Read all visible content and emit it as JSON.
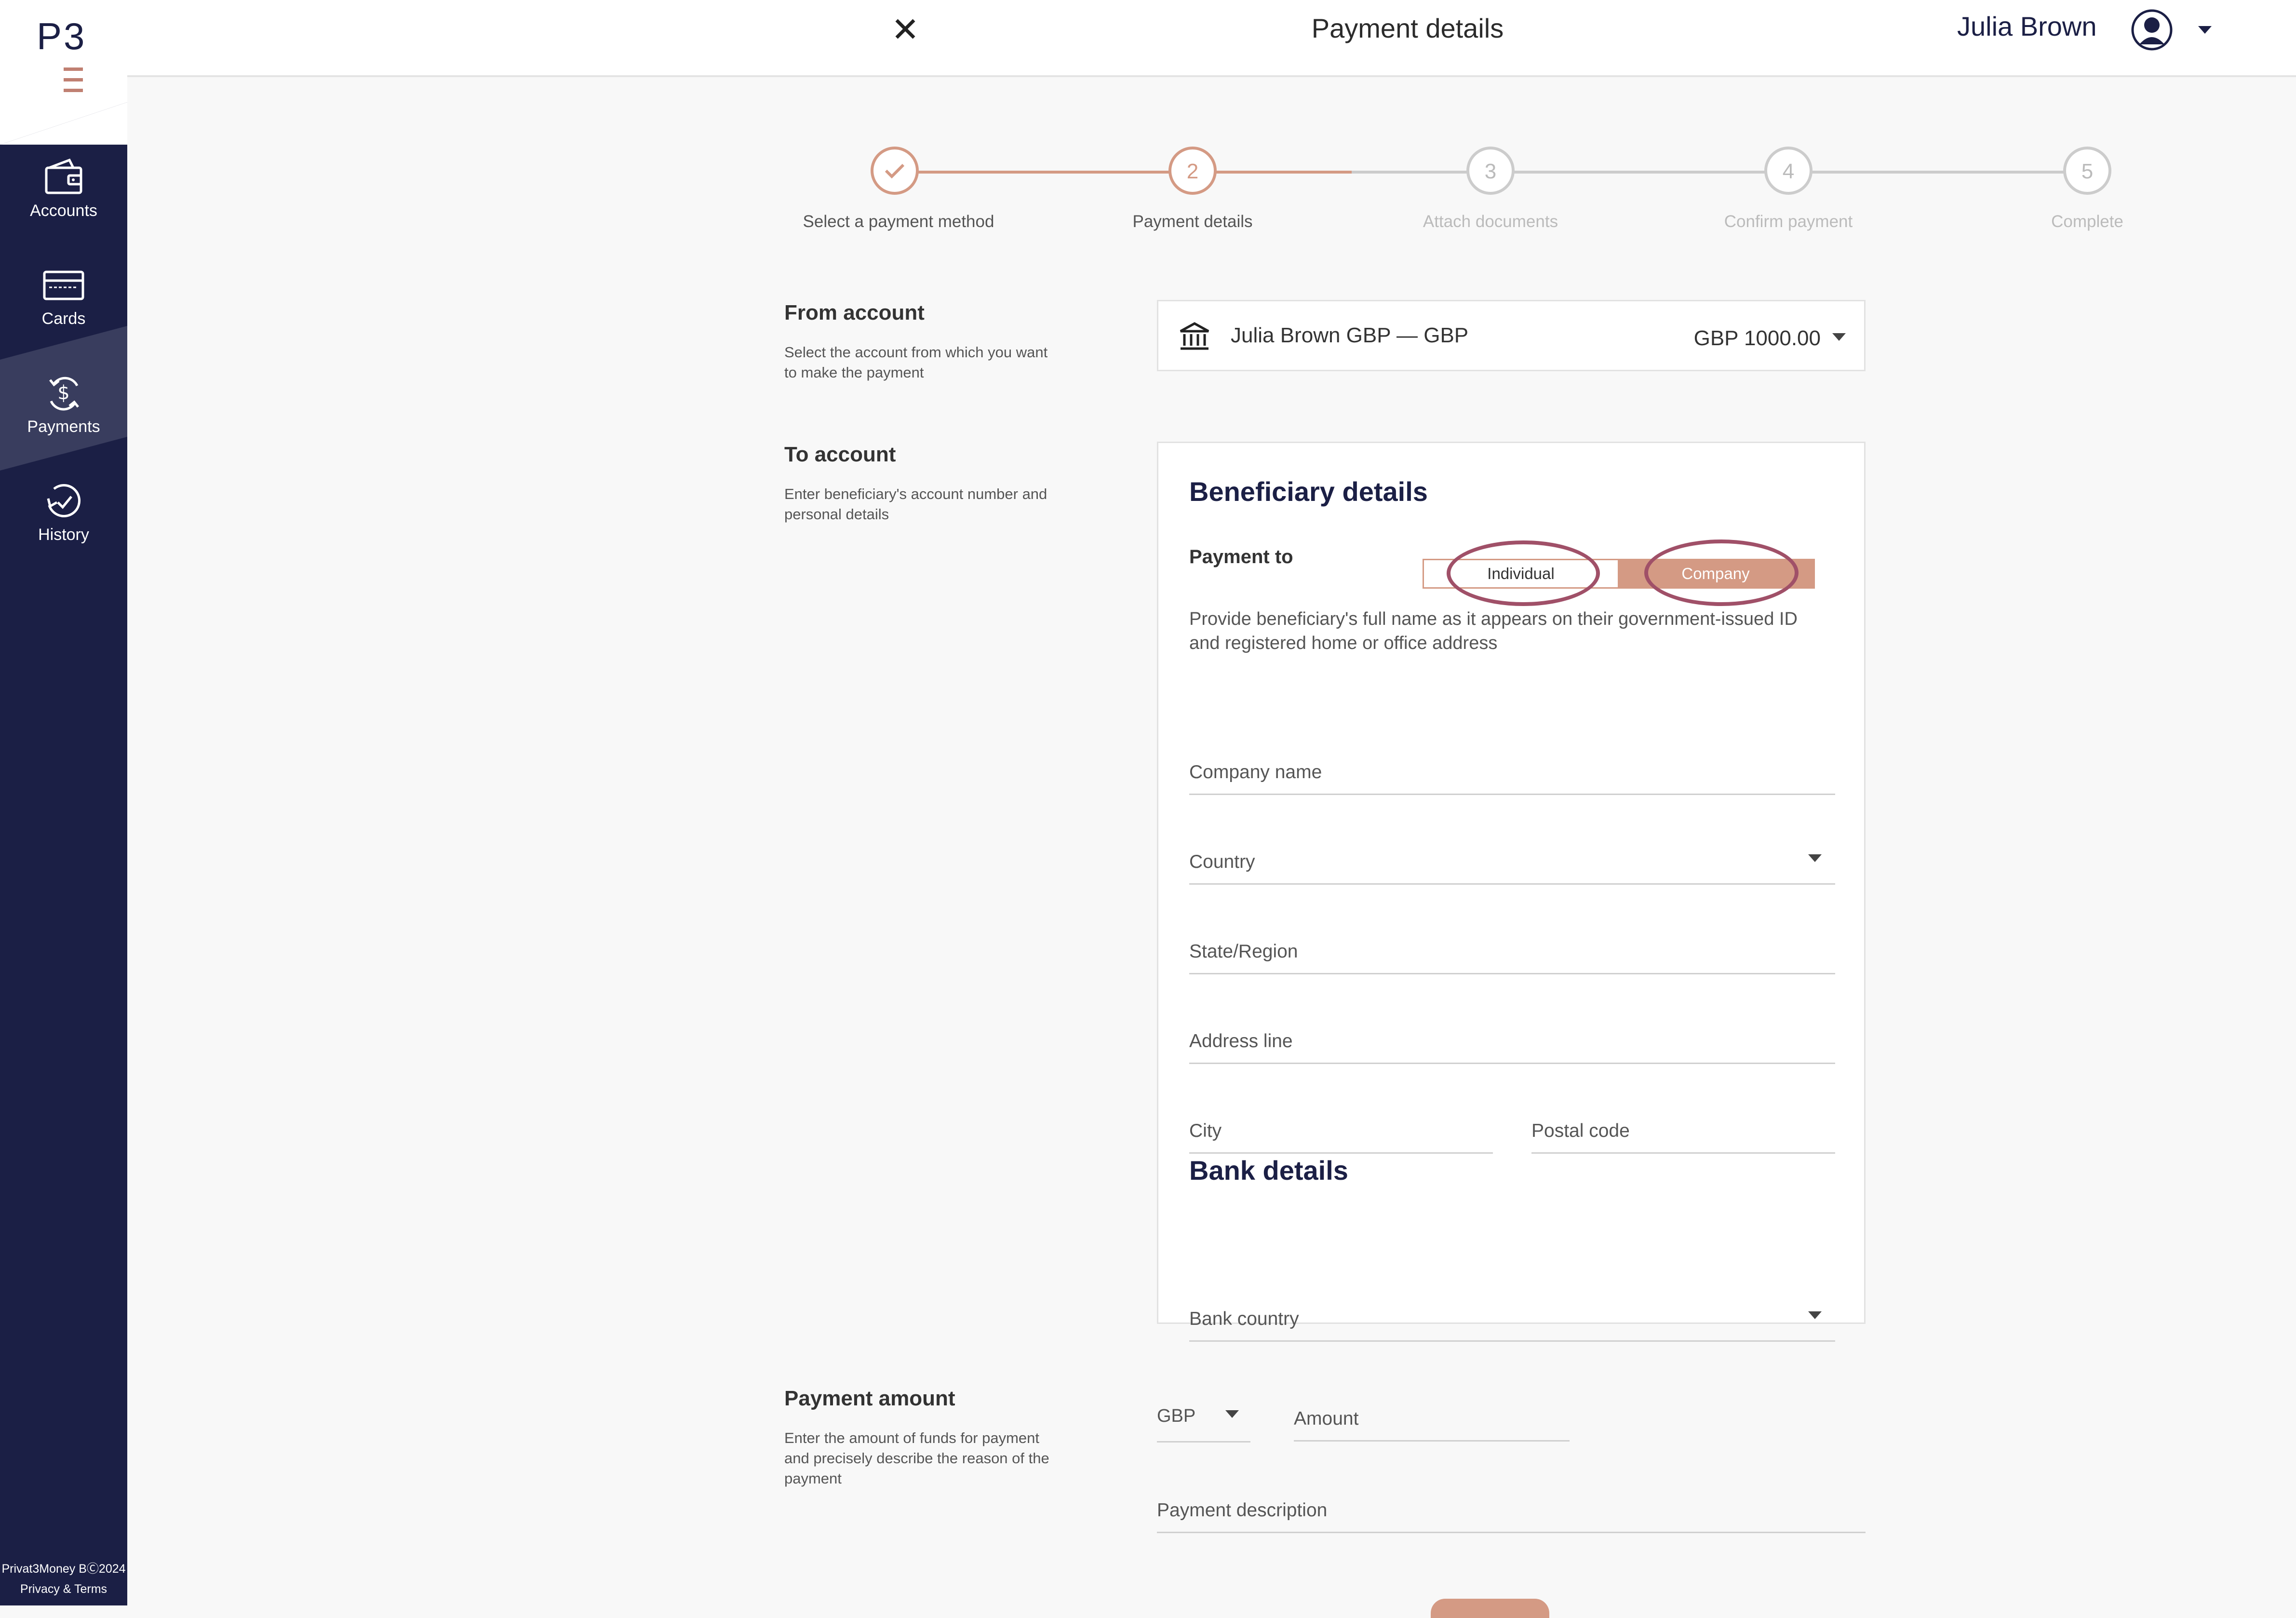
{
  "brand": {
    "logo_text": "P3"
  },
  "sidebar": {
    "items": [
      {
        "label": "Accounts",
        "icon": "wallet-icon",
        "active": false
      },
      {
        "label": "Cards",
        "icon": "card-icon",
        "active": false
      },
      {
        "label": "Payments",
        "icon": "payments-icon",
        "active": true
      },
      {
        "label": "History",
        "icon": "history-icon",
        "active": false
      }
    ],
    "footer": {
      "copyright": "Privat3Money BⒸ2024",
      "privacy": "Privacy & Terms"
    }
  },
  "header": {
    "title": "Payment details",
    "user_name": "Julia Brown"
  },
  "stepper": {
    "steps": [
      {
        "number": "",
        "label": "Select a payment method",
        "state": "done"
      },
      {
        "number": "2",
        "label": "Payment details",
        "state": "current"
      },
      {
        "number": "3",
        "label": "Attach documents",
        "state": "upcoming"
      },
      {
        "number": "4",
        "label": "Confirm payment",
        "state": "upcoming"
      },
      {
        "number": "5",
        "label": "Complete",
        "state": "upcoming"
      }
    ]
  },
  "from_account": {
    "title": "From account",
    "description": "Select the account from which you want to make the payment",
    "selected_account": "Julia Brown GBP — GBP",
    "balance": "GBP 1000.00"
  },
  "to_account": {
    "title": "To account",
    "description": "Enter beneficiary's account number and personal details"
  },
  "beneficiary": {
    "title": "Beneficiary details",
    "payment_to_label": "Payment to",
    "options": [
      "Individual",
      "Company"
    ],
    "selected_option": "Company",
    "description": "Provide beneficiary's full name as it appears on their government-issued ID and registered home or office address",
    "fields": {
      "company_name": "Company name",
      "country": "Country",
      "state_region": "State/Region",
      "address_line": "Address line",
      "city": "City",
      "postal_code": "Postal code"
    }
  },
  "bank_details": {
    "title": "Bank details",
    "bank_country": "Bank country"
  },
  "payment_amount": {
    "title": "Payment amount",
    "description": "Enter the amount of funds for payment and precisely describe the reason of the payment",
    "currency": "GBP",
    "amount_placeholder": "Amount",
    "description_placeholder": "Payment description"
  },
  "colors": {
    "sidebar_bg": "#1b1f45",
    "accent": "#d49a84",
    "highlight_ring": "#a05068",
    "title_dark": "#1b1f45"
  }
}
